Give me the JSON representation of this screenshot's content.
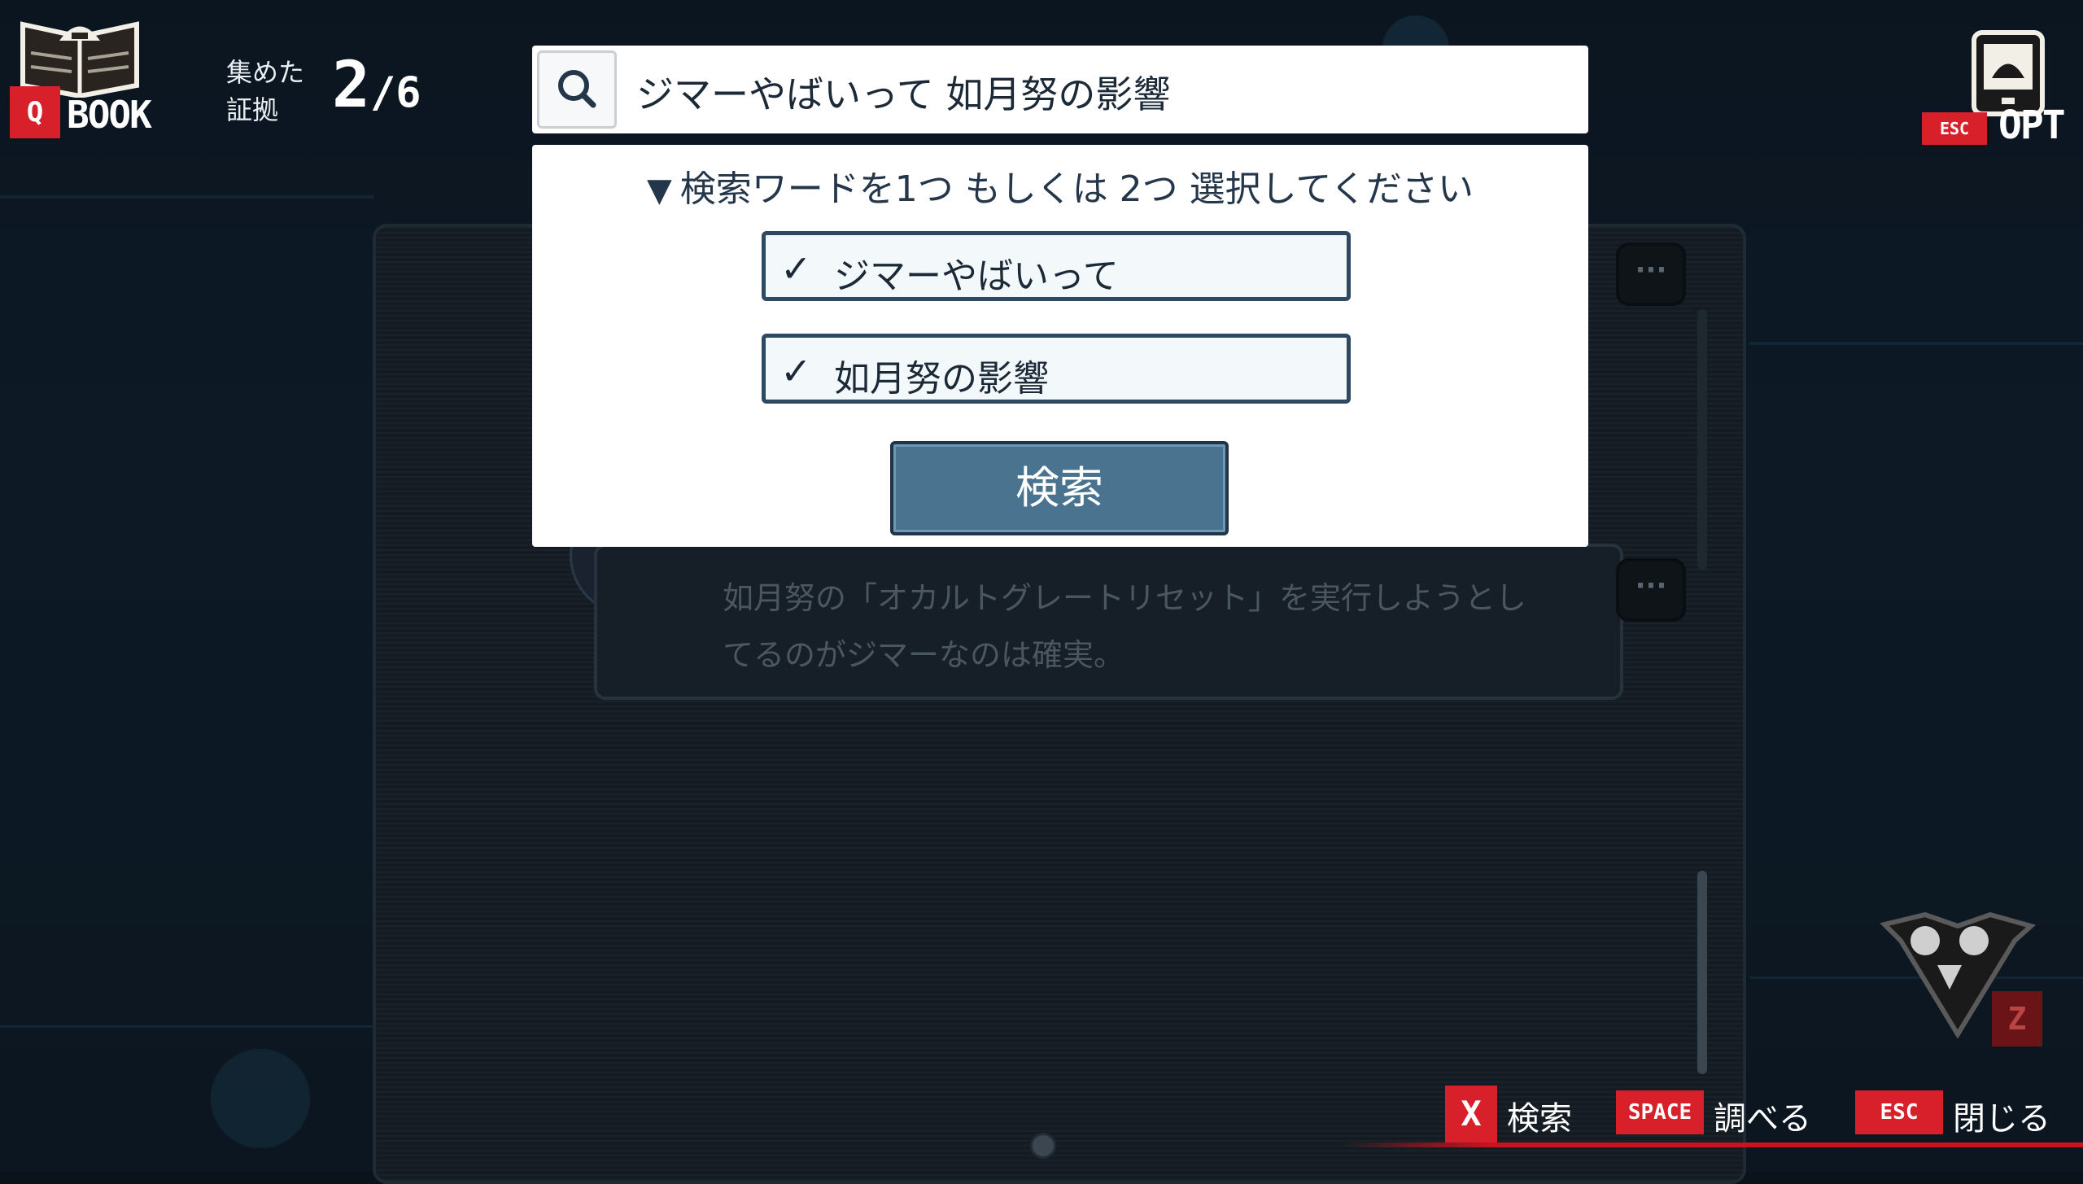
{
  "hud": {
    "book": {
      "key": "Q",
      "label": "BOOK"
    },
    "evidence": {
      "label_line1": "集めた",
      "label_line2": "証拠",
      "collected": "2",
      "separator": "/",
      "total": "6"
    },
    "options": {
      "key": "ESC",
      "label": "OPT"
    }
  },
  "search": {
    "query": "ジマーやばいって 如月努の影響"
  },
  "dialog": {
    "instruction": "検索ワードを1つ もしくは 2つ 選択してください",
    "instruction_marker": "▼",
    "choices": [
      {
        "label": "ジマーやばいって",
        "checked": true,
        "check_glyph": "✓"
      },
      {
        "label": "如月努の影響",
        "checked": true,
        "check_glyph": "✓"
      }
    ],
    "submit_label": "検索"
  },
  "background_chat": {
    "message": "如月努の「オカルトグレートリセット」を実行しようとしてるのがジマーなのは確実。"
  },
  "controls": [
    {
      "key": "X",
      "label": "検索"
    },
    {
      "key": "SPACE",
      "label": "調べる"
    },
    {
      "key": "ESC",
      "label": "閉じる"
    }
  ],
  "corner_key": "Z",
  "colors": {
    "accent_red": "#d8202a",
    "button_blue": "#4a7390",
    "border_navy": "#2d4a62"
  }
}
